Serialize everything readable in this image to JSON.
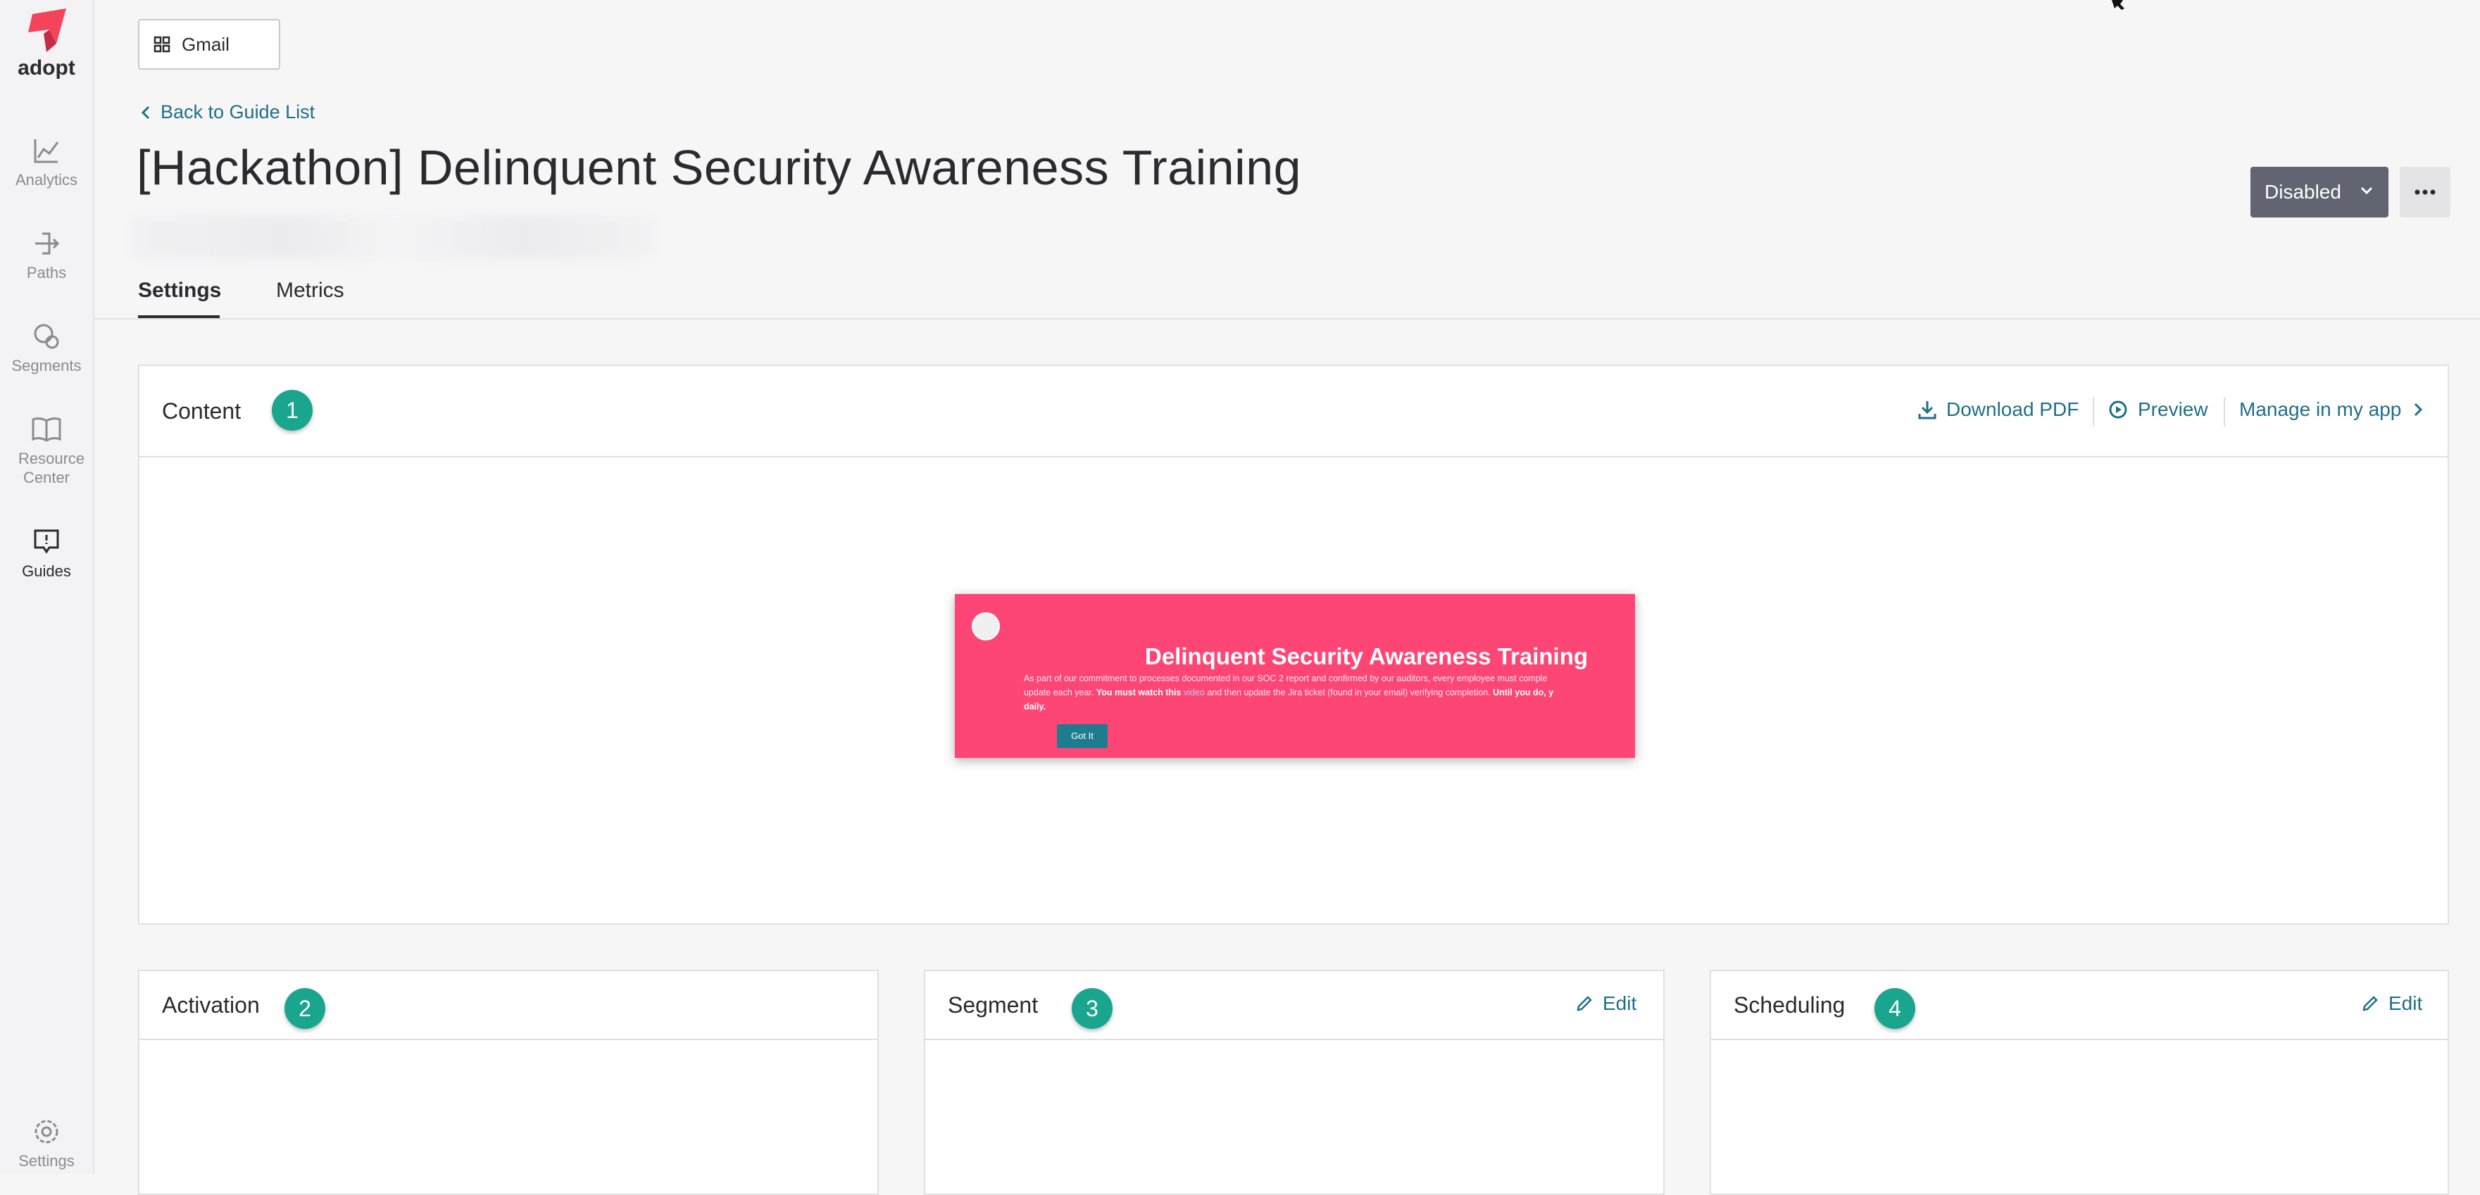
{
  "sidebar": {
    "logo_text": "adopt",
    "items": [
      {
        "label": "Analytics"
      },
      {
        "label": "Paths"
      },
      {
        "label": "Segments"
      },
      {
        "label": "Resource Center"
      },
      {
        "label": "Guides"
      },
      {
        "label": "Settings"
      }
    ],
    "active": "Guides"
  },
  "app_selector": {
    "label": "Gmail"
  },
  "breadcrumb": {
    "back_label": "Back to Guide List"
  },
  "guide": {
    "title": "[Hackathon] Delinquent Security Awareness Training",
    "status": "Disabled"
  },
  "tabs": [
    {
      "label": "Settings",
      "active": true
    },
    {
      "label": "Metrics",
      "active": false
    }
  ],
  "content_card": {
    "title": "Content",
    "step": "1",
    "actions": {
      "download": "Download PDF",
      "preview": "Preview",
      "manage": "Manage in my app"
    }
  },
  "guide_preview": {
    "title": "Delinquent Security Awareness Training",
    "body_part1": "As part of our commitment to processes documented in our SOC 2 report and confirmed by our auditors, every employee must comple",
    "body_part2": "update each year. ",
    "body_bold1": "You must watch this ",
    "body_link": "video",
    "body_part3": " and then update the Jira ticket (found in your email) verifying completion. ",
    "body_bold2": "Until you do, y",
    "body_bold3": "daily.",
    "button_label": "Got It"
  },
  "activation_card": {
    "title": "Activation",
    "step": "2"
  },
  "segment_card": {
    "title": "Segment",
    "step": "3",
    "edit_label": "Edit"
  },
  "scheduling_card": {
    "title": "Scheduling",
    "step": "4",
    "edit_label": "Edit"
  },
  "colors": {
    "accent_link": "#1f6f89",
    "step_badge": "#1aa68e",
    "guide_background": "#fd4675",
    "status_button": "#616471"
  },
  "icons": [
    "adopt-logo-icon",
    "analytics-icon",
    "paths-icon",
    "segments-icon",
    "resource-center-icon",
    "guides-icon",
    "settings-icon",
    "grid-icon",
    "chevron-left-icon",
    "chevron-down-icon",
    "more-icon",
    "download-icon",
    "play-circle-icon",
    "chevron-right-icon",
    "pencil-icon"
  ]
}
